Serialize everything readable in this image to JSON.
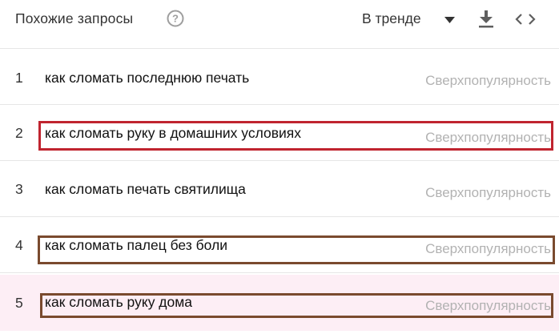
{
  "header": {
    "title": "Похожие запросы",
    "filter_label": "В тренде",
    "help_icon": "help-circle-icon",
    "dropdown_icon": "triangle-down-icon",
    "download_icon": "download-icon",
    "embed_icon": "code-embed-icon"
  },
  "rows": [
    {
      "rank": "1",
      "query": "как сломать последнюю печать",
      "value": "Сверхпопулярность"
    },
    {
      "rank": "2",
      "query": "как сломать руку в домашних условиях",
      "value": "Сверхпопулярность"
    },
    {
      "rank": "3",
      "query": "как сломать печать святилища",
      "value": "Сверхпопулярность"
    },
    {
      "rank": "4",
      "query": "как сломать палец без боли",
      "value": "Сверхпопулярность"
    },
    {
      "rank": "5",
      "query": "как сломать руку дома",
      "value": "Сверхпопулярность"
    }
  ],
  "highlight_colors": {
    "row2": "#c0242f",
    "row4": "#7a4a2e",
    "row5": "#7a4a2e"
  }
}
